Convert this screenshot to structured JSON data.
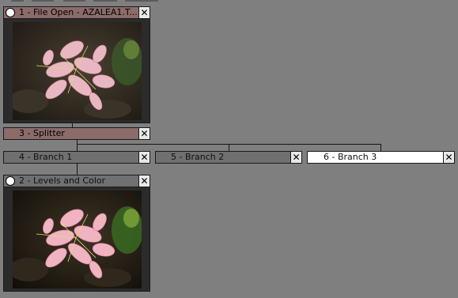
{
  "nodes": {
    "file_open": {
      "label": "1 - File Open - AZALEA1.T...",
      "close": "✕"
    },
    "splitter": {
      "label": "3 - Splitter",
      "close": "✕"
    },
    "branch1": {
      "label": "4 - Branch 1",
      "close": "✕"
    },
    "branch2": {
      "label": "5 - Branch 2",
      "close": "✕"
    },
    "branch3": {
      "label": "6 - Branch 3",
      "close": "✕"
    },
    "levels": {
      "label": "2 - Levels and Color",
      "close": "✕"
    }
  },
  "colors": {
    "workspace": "#7f7f7f",
    "title_pink": "#8c6b6b",
    "title_grey": "#707070",
    "title_selected": "#ffffff"
  },
  "icons": {
    "preview_toggle": "circle-icon",
    "close": "close-icon",
    "image": "azalea-flower-image"
  }
}
